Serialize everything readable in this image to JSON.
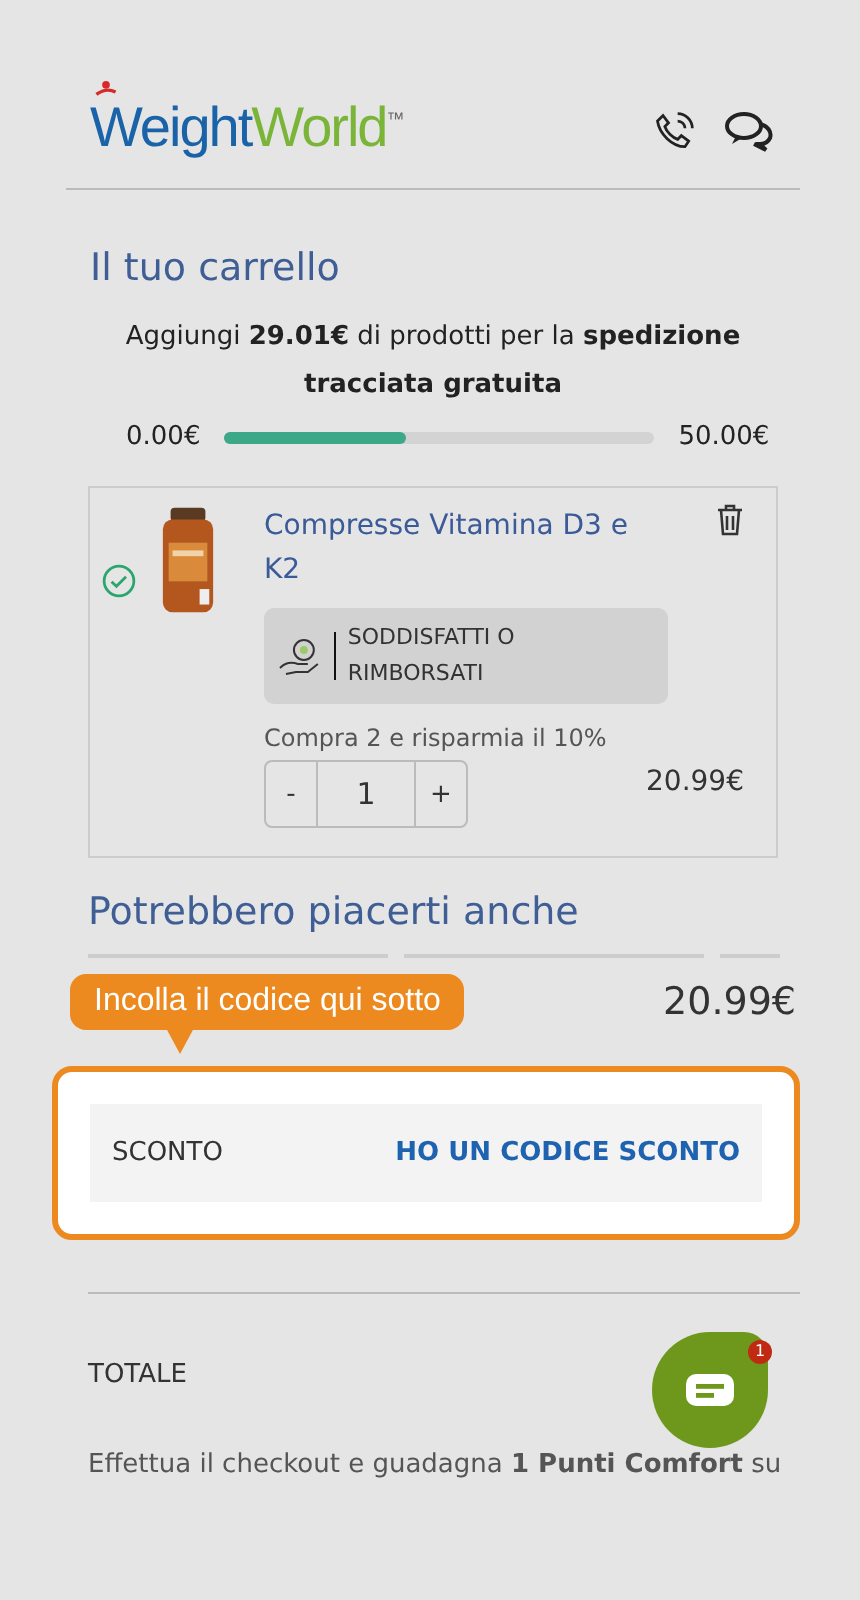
{
  "header": {
    "logo_first": "Weight",
    "logo_second": "World",
    "logo_mark": "™"
  },
  "cart": {
    "title": "Il tuo carrello",
    "shipping_message": "Aggiungi **29.01€** di prodotti per la **spedizione tracciata gratuita**",
    "progress": {
      "min": "0.00€",
      "max": "50.00€",
      "level": 0.42
    },
    "items": [
      {
        "name": "Compresse Vitamina D3 e K2",
        "selected": true,
        "guarantee": "SODDISFATTI O RIMBORSATI",
        "offer": "Compra 2 e risparmia il 10%",
        "decrement": "-",
        "quantity": "1",
        "increment": "+",
        "price": "20.99€"
      }
    ]
  },
  "recommendations": {
    "title": "Potrebbero piacerti anche",
    "price": "20.99€"
  },
  "tooltip": "Incolla il codice qui sotto",
  "discount": {
    "label": "SCONTO",
    "link": "HO UN CODICE SCONTO"
  },
  "total": {
    "label": "TOTALE"
  },
  "chat": {
    "badge": "1"
  },
  "points_message": "Effettua il checkout e guadagna **1 Punti Comfort** su"
}
